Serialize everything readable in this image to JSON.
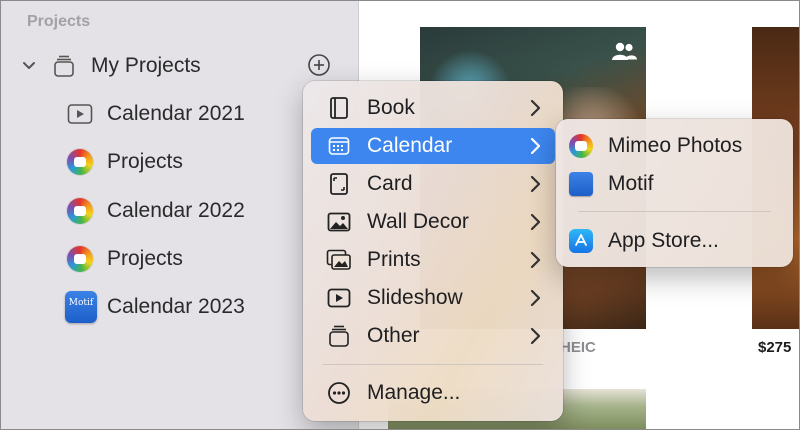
{
  "sidebar": {
    "section_title": "Projects",
    "my_projects_label": "My Projects",
    "items": [
      {
        "label": "Calendar 2021",
        "icon": "slideshow-icon"
      },
      {
        "label": "Projects",
        "icon": "photos-app-icon"
      },
      {
        "label": "Calendar 2022",
        "icon": "photos-app-icon"
      },
      {
        "label": "Projects",
        "icon": "photos-app-icon"
      },
      {
        "label": "Calendar 2023",
        "icon": "motif-app-icon",
        "icon_text": "Motif"
      }
    ]
  },
  "content": {
    "heic_label": "HEIC",
    "price_label": "$275"
  },
  "menu": {
    "items": [
      {
        "label": "Book",
        "icon": "book-icon",
        "has_submenu": true
      },
      {
        "label": "Calendar",
        "icon": "calendar-icon",
        "has_submenu": true,
        "selected": true
      },
      {
        "label": "Card",
        "icon": "card-icon",
        "has_submenu": true
      },
      {
        "label": "Wall Decor",
        "icon": "wall-decor-icon",
        "has_submenu": true
      },
      {
        "label": "Prints",
        "icon": "prints-icon",
        "has_submenu": true
      },
      {
        "label": "Slideshow",
        "icon": "slideshow-icon",
        "has_submenu": true
      },
      {
        "label": "Other",
        "icon": "other-icon",
        "has_submenu": true
      }
    ],
    "manage_label": "Manage..."
  },
  "submenu": {
    "items": [
      {
        "label": "Mimeo Photos",
        "icon": "photos-app-icon"
      },
      {
        "label": "Motif",
        "icon": "motif-app-icon"
      }
    ],
    "app_store_label": "App Store..."
  },
  "colors": {
    "accent": "#3d86ef",
    "sidebar_bg": "#e4e2e6"
  }
}
